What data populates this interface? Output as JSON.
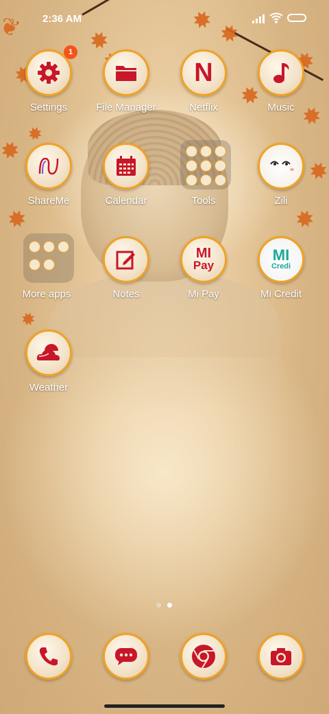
{
  "status_bar": {
    "time": "2:36 AM"
  },
  "home": {
    "apps": [
      {
        "label": "Settings",
        "badge": "1"
      },
      {
        "label": "File Manager"
      },
      {
        "label": "Netflix"
      },
      {
        "label": "Music"
      },
      {
        "label": "ShareMe"
      },
      {
        "label": "Calendar"
      },
      {
        "label": "Tools"
      },
      {
        "label": "Zili"
      },
      {
        "label": "More apps"
      },
      {
        "label": "Notes"
      },
      {
        "label": "Mi Pay"
      },
      {
        "label": "Mi Credit"
      },
      {
        "label": "Weather"
      }
    ],
    "netflix_glyph": "N",
    "mipay_text": {
      "line1": "MI",
      "line2": "Pay"
    },
    "micredit_text": {
      "line1": "MI",
      "line2": "Credi"
    }
  },
  "page_indicator": {
    "pages": 2,
    "active": 2
  },
  "dock": [
    {
      "name": "Phone"
    },
    {
      "name": "Messaging"
    },
    {
      "name": "Chrome"
    },
    {
      "name": "Camera"
    }
  ],
  "colors": {
    "icon_red": "#c8162a",
    "ring": "#f0a224",
    "badge": "#f2541c",
    "dot_active": "#ffffff",
    "dot_inactive": "#e8d7be"
  }
}
